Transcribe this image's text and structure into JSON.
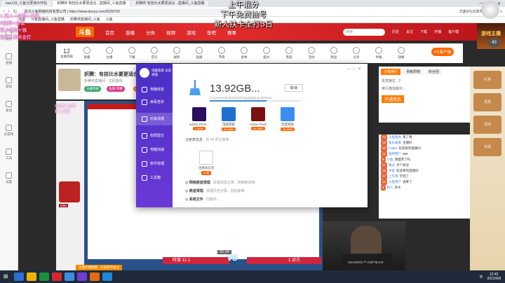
{
  "browser": {
    "tabs": [
      "bas133_斗鱼分屏演示开始",
      "折腾帅 有挂比水要更适合...直播间_斗鱼直播",
      "折腾帅 有挂比水要更适合...直播间_斗鱼直播"
    ],
    "url": "https://www.douyu.com/5290769",
    "secure_label": "武汉斗鱼网络科技有限公司",
    "tools": [
      "华夏iOS15发布"
    ],
    "bookmarks": [
      "书签",
      "斗鱼直播间_斗鱼直播",
      "折腾帅直播间_斗鱼",
      "斗鱼"
    ]
  },
  "rail": [
    "视频",
    "直播",
    "游戏",
    "发现",
    "云游戏",
    "工具",
    "设置"
  ],
  "site": {
    "logo": "斗鱼",
    "nav": [
      "首页",
      "直播",
      "分类",
      "视频",
      "游戏",
      "鱼吧",
      "赛事"
    ],
    "search_placeholder": "搜索",
    "header_icons": [
      "历史",
      "关注",
      "下载",
      "开播",
      "客户端"
    ]
  },
  "promo_text": "游戏主播",
  "categories": {
    "level": "12",
    "level_label": "主播等级",
    "items": [
      "直播",
      "主播",
      "下播",
      "音乐",
      "福利",
      "鱼塘",
      "节目",
      "星秀",
      "超大",
      "贵族",
      "活动",
      "粉丝",
      "分享",
      "举报",
      "快捷"
    ],
    "pc_button": "PC客户端",
    "count": "43"
  },
  "room": {
    "title": "折腾：有挂比水要更适合",
    "subtitle": "折腾帅直播间 · 主机游戏",
    "chips": [
      "主播等级",
      "鱼塘·荣耀",
      "主播之星"
    ]
  },
  "stream": {
    "gift_label": "0/68",
    "follow_banner": "主播开播提醒 · 点击即可关注"
  },
  "dialog": {
    "brand": "电脑管家 垃圾清理",
    "nav": [
      "电脑体检",
      "病毒查杀",
      "垃圾清理",
      "权限雷达",
      "电脑加速",
      "软件管理",
      "工具箱"
    ],
    "active_nav_index": 2,
    "window_controls": [
      "—",
      "□",
      "✕"
    ],
    "total_size": "13.92GB...",
    "cancel_label": "取消",
    "path": "C:\\Users\\Administrator\\AppData\\Local\\Temp",
    "progress": 0.62,
    "apps": [
      {
        "name": "adobe Prem...",
        "size": "1.8GB",
        "color": "#2a0d5c"
      },
      {
        "name": "电脑管家",
        "size": "84.6MB",
        "color": "#1f6fd1"
      },
      {
        "name": "Adobe Flash",
        "size": "64.3MB",
        "color": "#7a1010"
      },
      {
        "name": "百度网盘",
        "size": "38.6MB",
        "color": "#3b8ef0"
      }
    ],
    "reg_info_label": "注册表信息",
    "reg_info_note": "共 44 项注册表",
    "reg": {
      "name": "注册表信息",
      "size": "44项"
    },
    "rows": [
      {
        "label": "网络痕迹清理",
        "note": "清理浏览记录、搜索痕迹等"
      },
      {
        "label": "痕迹清理",
        "note": "清理历史记录、剪贴板等"
      },
      {
        "label": "系统文件",
        "note": "扫描中..."
      }
    ]
  },
  "rank": {
    "tabs": [
      "主播排行",
      "贡献周榜",
      "粉丝团"
    ],
    "active_tab": 0,
    "rows": [
      "贵宾席位 · 2",
      "排行榜加载中…"
    ],
    "action": "开通贵族"
  },
  "chat": [
    {
      "level": "24",
      "user": "斗鱼鱼丸",
      "text": "来了啊"
    },
    {
      "level": "18",
      "user": "鱼丸拿来",
      "text": "主播好"
    },
    {
      "level": "30",
      "user": "Coder",
      "text": "欢迎来到直播间"
    },
    {
      "level": "12",
      "user": "鱼吧用户",
      "text": "666"
    },
    {
      "level": "9",
      "user": "小鱼",
      "text": "清理完了吗"
    },
    {
      "level": "21",
      "user": "路过",
      "text": "点个关注"
    },
    {
      "level": "16",
      "user": "水友",
      "text": "欢迎来到直播间"
    },
    {
      "level": "27",
      "user": "上午场",
      "text": "学到了"
    },
    {
      "level": "15",
      "user": "斗鱼用户",
      "text": "进来了"
    },
    {
      "level": "8",
      "user": "新人",
      "text": "求水"
    }
  ],
  "gold": [
    "礼物",
    "贵族",
    "活动",
    "充值"
  ],
  "webcam": {
    "shirt_text": "VEASROC™ AOFTEAAT"
  },
  "pk": {
    "timer": "02:34",
    "left_name": "折腾帅",
    "right_name": "左岸",
    "left_score": "阵营 11.1",
    "right_score": "1 对方",
    "vs": "VS"
  },
  "overlays": {
    "center_lines": [
      "上午混分",
      "下午免费抽号",
      "新人扶卡全打3日"
    ],
    "left_lines": [
      "1.新人+房管+主机",
      "8级牌+房管",
      "新人进群+钱",
      "抽奖+刷卡全打"
    ],
    "left2_lines": [
      "8级牌+房管",
      "新人进群"
    ]
  },
  "taskbar": {
    "time": "12:42",
    "date": "2021/6/8",
    "ime": "中",
    "icons": [
      "#2b6fd6",
      "#f0b400",
      "#1a8f3a",
      "#d8262c",
      "#3a8de0",
      "#6e3bd6",
      "#e26b16",
      "#1f87d8"
    ]
  }
}
